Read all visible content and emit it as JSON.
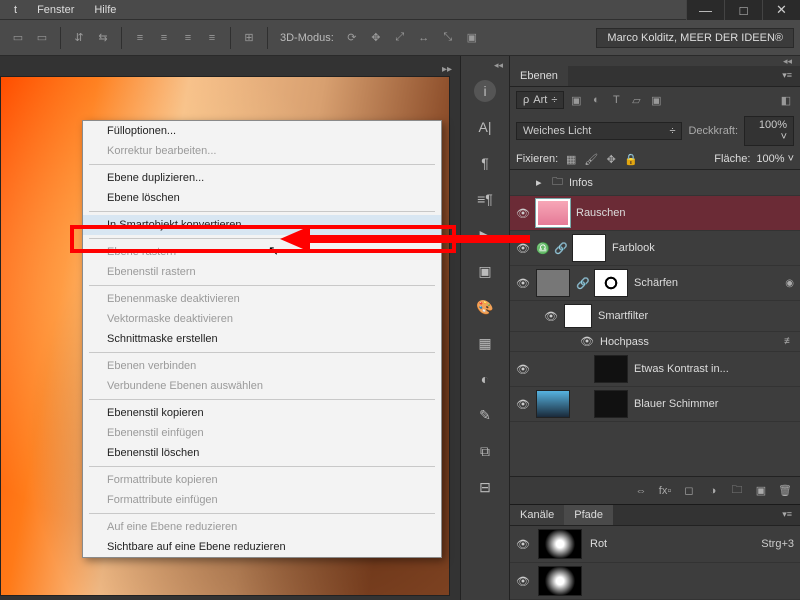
{
  "menubar": {
    "items": [
      "t",
      "Fenster",
      "Hilfe"
    ]
  },
  "toolbar": {
    "mode_label": "3D-Modus:",
    "user": "Marco Kolditz, MEER DER IDEEN®"
  },
  "context_menu": {
    "groups": [
      [
        {
          "label": "Fülloptionen...",
          "enabled": true
        },
        {
          "label": "Korrektur bearbeiten...",
          "enabled": false
        }
      ],
      [
        {
          "label": "Ebene duplizieren...",
          "enabled": true
        },
        {
          "label": "Ebene löschen",
          "enabled": true
        }
      ],
      [
        {
          "label": "In Smartobjekt konvertieren",
          "enabled": true,
          "highlight": true
        }
      ],
      [
        {
          "label": "Ebene rastern",
          "enabled": false
        },
        {
          "label": "Ebenenstil rastern",
          "enabled": false
        }
      ],
      [
        {
          "label": "Ebenenmaske deaktivieren",
          "enabled": false
        },
        {
          "label": "Vektormaske deaktivieren",
          "enabled": false
        },
        {
          "label": "Schnittmaske erstellen",
          "enabled": true
        }
      ],
      [
        {
          "label": "Ebenen verbinden",
          "enabled": false
        },
        {
          "label": "Verbundene Ebenen auswählen",
          "enabled": false
        }
      ],
      [
        {
          "label": "Ebenenstil kopieren",
          "enabled": true
        },
        {
          "label": "Ebenenstil einfügen",
          "enabled": false
        },
        {
          "label": "Ebenenstil löschen",
          "enabled": true
        }
      ],
      [
        {
          "label": "Formattribute kopieren",
          "enabled": false
        },
        {
          "label": "Formattribute einfügen",
          "enabled": false
        }
      ],
      [
        {
          "label": "Auf eine Ebene reduzieren",
          "enabled": false
        },
        {
          "label": "Sichtbare auf eine Ebene reduzieren",
          "enabled": true
        }
      ]
    ]
  },
  "panels": {
    "layers_tab": "Ebenen",
    "kind_label": "Art",
    "blend_mode": "Weiches Licht",
    "opacity_label": "Deckkraft:",
    "opacity_value": "100%",
    "lock_label": "Fixieren:",
    "fill_label": "Fläche:",
    "fill_value": "100%",
    "group_infos": "Infos",
    "layers": [
      {
        "name": "Rauschen"
      },
      {
        "name": "Farblook"
      },
      {
        "name": "Schärfen"
      },
      {
        "name": "Smartfilter"
      },
      {
        "name": "Hochpass"
      },
      {
        "name": "Etwas Kontrast in..."
      },
      {
        "name": "Blauer Schimmer"
      }
    ],
    "fx_label": "fx",
    "channels_tab": "Kanäle",
    "paths_tab": "Pfade",
    "channel_red": "Rot",
    "channel_red_sc": "Strg+3"
  }
}
